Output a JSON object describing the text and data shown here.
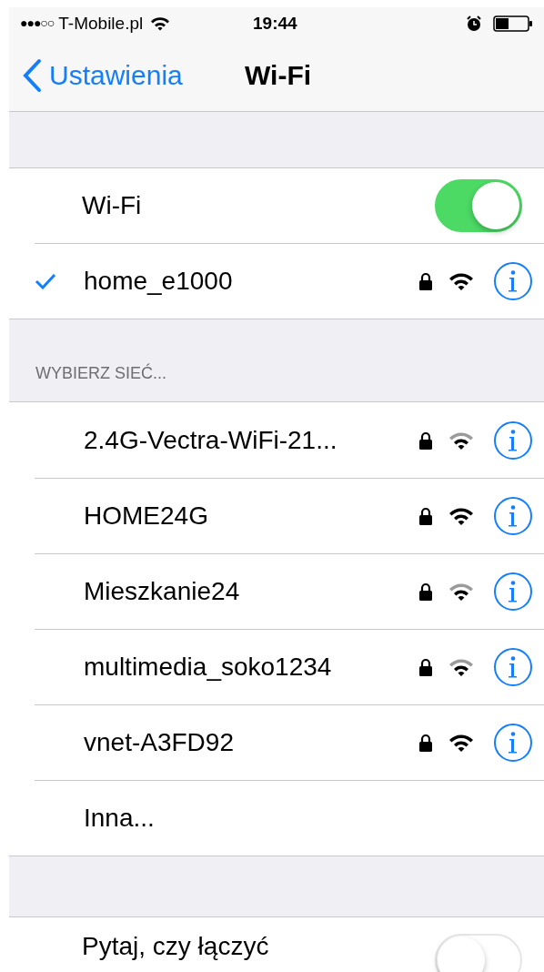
{
  "status_bar": {
    "signal_dots": "●●●○○",
    "carrier": "T-Mobile.pl",
    "time": "19:44"
  },
  "nav": {
    "back": "Ustawienia",
    "title": "Wi-Fi"
  },
  "wifi_toggle": {
    "label": "Wi-Fi",
    "on": true
  },
  "connected": {
    "name": "home_e1000",
    "selected": true,
    "locked": true,
    "full_signal": true
  },
  "section_header": "WYBIERZ SIEĆ...",
  "networks": [
    {
      "name": "2.4G-Vectra-WiFi-21...",
      "locked": true,
      "full_signal": false
    },
    {
      "name": "HOME24G",
      "locked": true,
      "full_signal": true
    },
    {
      "name": "Mieszkanie24",
      "locked": true,
      "full_signal": false
    },
    {
      "name": "multimedia_soko1234",
      "locked": true,
      "full_signal": false
    },
    {
      "name": "vnet-A3FD92",
      "locked": true,
      "full_signal": true
    }
  ],
  "other": "Inna...",
  "ask_toggle": {
    "label": "Pytaj, czy łączyć",
    "on": false
  }
}
